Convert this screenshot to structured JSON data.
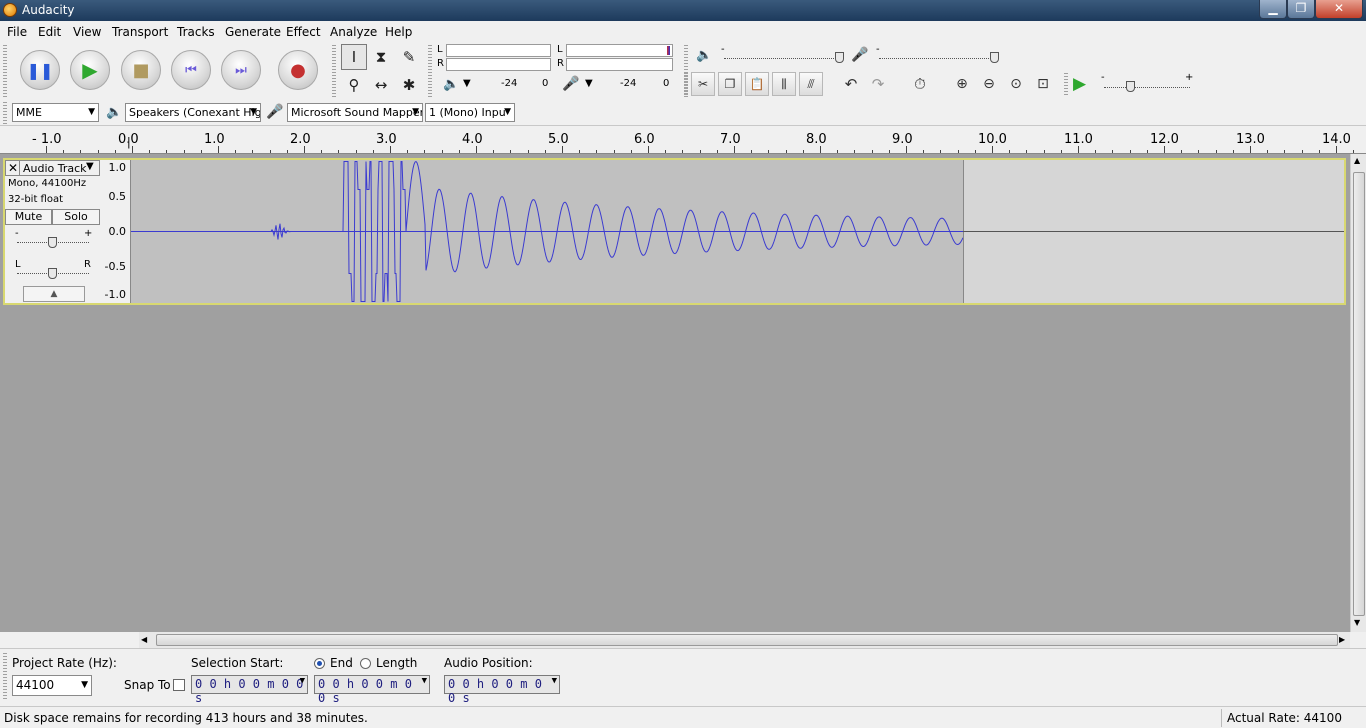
{
  "window": {
    "title": "Audacity",
    "minimize_glyph": "▁",
    "maximize_glyph": "❐",
    "close_glyph": "✕"
  },
  "menu": [
    "File",
    "Edit",
    "View",
    "Transport",
    "Tracks",
    "Generate",
    "Effect",
    "Analyze",
    "Help"
  ],
  "meters": {
    "play_L": "L",
    "play_R": "R",
    "rec_L": "L",
    "rec_R": "R",
    "play_scale": [
      "-24",
      "0"
    ],
    "rec_scale": [
      "-24",
      "0"
    ]
  },
  "mixer": {
    "minus": "-",
    "plus": "+"
  },
  "device": {
    "host": "MME",
    "output": "Speakers (Conexant Hig",
    "input": "Microsoft Sound Mapper",
    "channels": "1 (Mono) Inpu"
  },
  "ruler": {
    "labels": [
      "- 1.0",
      "0.0",
      "1.0",
      "2.0",
      "3.0",
      "4.0",
      "5.0",
      "6.0",
      "7.0",
      "8.0",
      "9.0",
      "10.0",
      "11.0",
      "12.0",
      "13.0",
      "14.0"
    ]
  },
  "track": {
    "name": "Audio Track",
    "info1": "Mono, 44100Hz",
    "info2": "32-bit float",
    "mute": "Mute",
    "solo": "Solo",
    "gain_minus": "-",
    "gain_plus": "+",
    "pan_L": "L",
    "pan_R": "R",
    "vruler": [
      "1.0",
      "0.5",
      "0.0",
      "-0.5",
      "-1.0"
    ],
    "wave_color": "#3b3bd0"
  },
  "selection": {
    "project_rate_label": "Project Rate (Hz):",
    "project_rate": "44100",
    "snap_to": "Snap To",
    "selection_start_label": "Selection Start:",
    "end_label": "End",
    "length_label": "Length",
    "audio_position_label": "Audio Position:",
    "start_time": "0 0 h 0 0 m 0 0 s",
    "end_time": "0 0 h 0 0 m 0 0 s",
    "position_time": "0 0 h 0 0 m 0 0 s"
  },
  "status": {
    "left": "Disk space remains for recording 413 hours and 38 minutes.",
    "right": "Actual Rate: 44100"
  }
}
